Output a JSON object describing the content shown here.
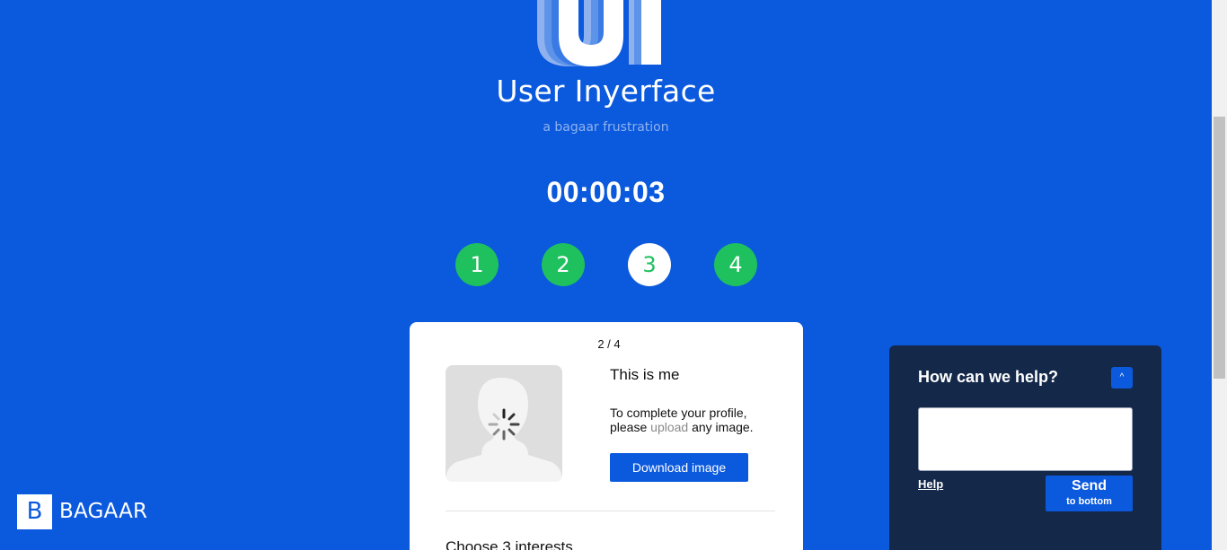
{
  "header": {
    "logo_letters": "UI",
    "title": "User Inyerface",
    "tagline": "a bagaar frustration"
  },
  "timer": "00:00:03",
  "steps": [
    {
      "label": "1",
      "state": "done"
    },
    {
      "label": "2",
      "state": "done"
    },
    {
      "label": "3",
      "state": "active"
    },
    {
      "label": "4",
      "state": "done"
    }
  ],
  "card": {
    "page_counter": "2 / 4",
    "section_title": "This is me",
    "profile_text_prefix": "To complete your profile, please ",
    "profile_text_link": "upload",
    "profile_text_suffix": " any image.",
    "download_button": "Download image",
    "interests_title": "Choose 3 interests"
  },
  "help": {
    "title": "How can we help?",
    "toggle_glyph": "^",
    "input_value": "",
    "help_link": "Help",
    "send_label": "Send",
    "send_sublabel": "to bottom"
  },
  "brand": {
    "mark": "B",
    "name": "BAGAAR"
  },
  "colors": {
    "background": "#0b59dd",
    "step_green": "#1fc15e",
    "help_panel": "#14284a"
  }
}
